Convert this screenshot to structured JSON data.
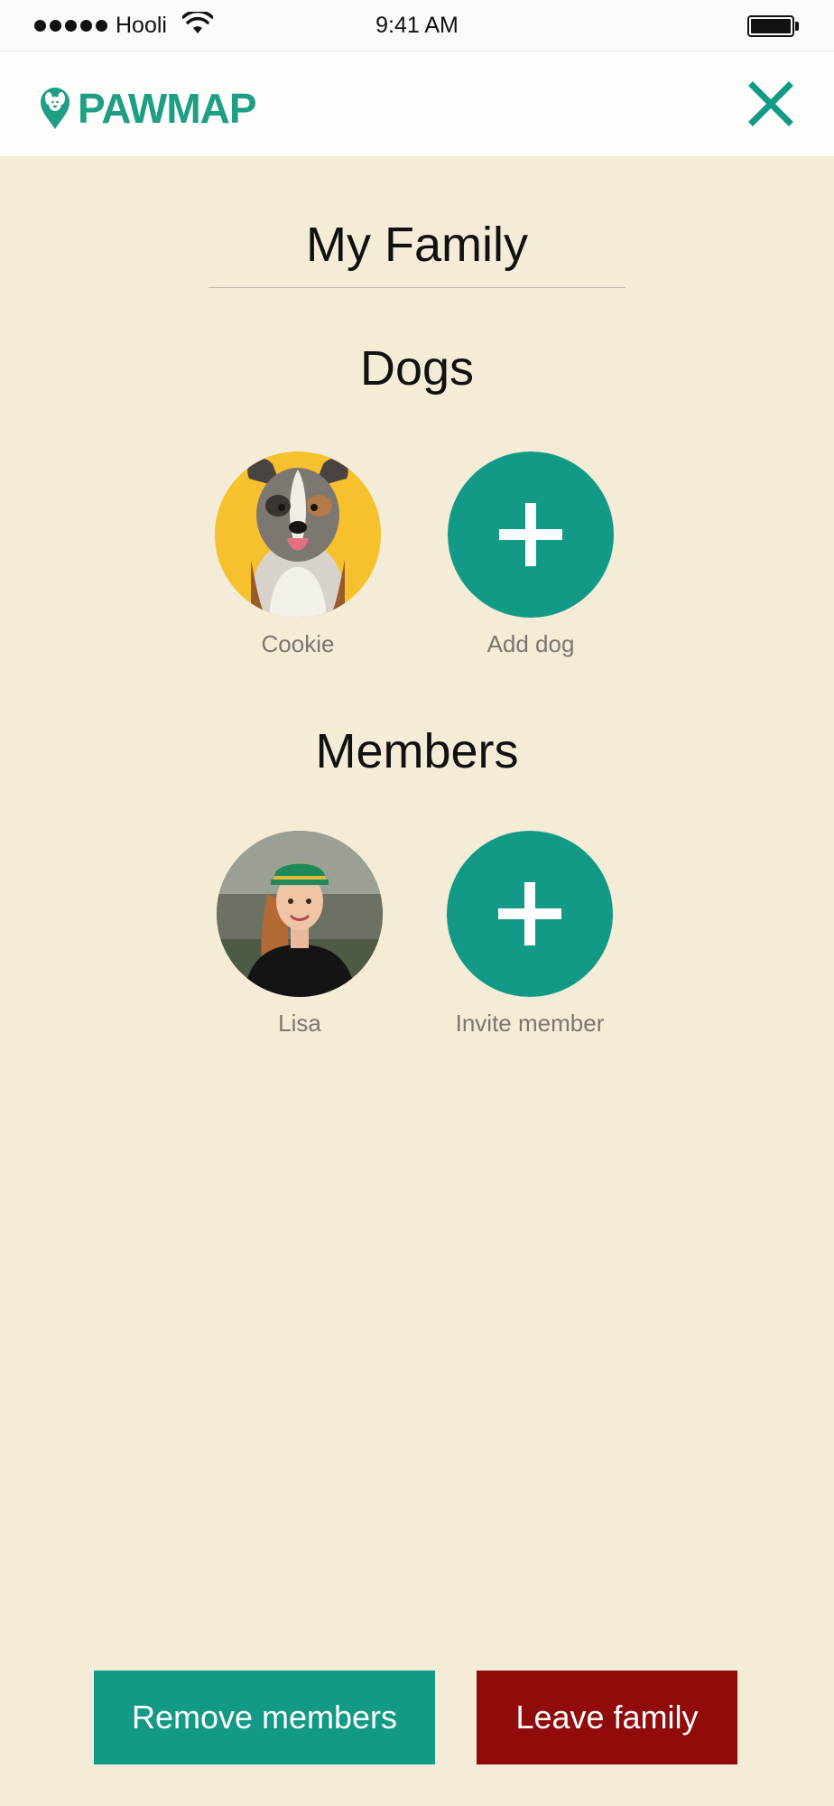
{
  "status_bar": {
    "carrier": "Hooli",
    "time": "9:41 AM",
    "icons": [
      "signal-dots-icon",
      "wifi-icon",
      "battery-icon"
    ]
  },
  "header": {
    "logo_text": "PAWMAP",
    "close_icon": "close-icon",
    "accent_color": "#1f9e86"
  },
  "page": {
    "title": "My Family"
  },
  "dogs": {
    "section_title": "Dogs",
    "items": [
      {
        "name": "Cookie"
      }
    ],
    "add_label": "Add dog"
  },
  "members": {
    "section_title": "Members",
    "items": [
      {
        "name": "Lisa"
      }
    ],
    "add_label": "Invite member"
  },
  "actions": {
    "remove_members": "Remove members",
    "leave_family": "Leave family",
    "remove_color": "#139a87",
    "leave_color": "#920b0b"
  }
}
